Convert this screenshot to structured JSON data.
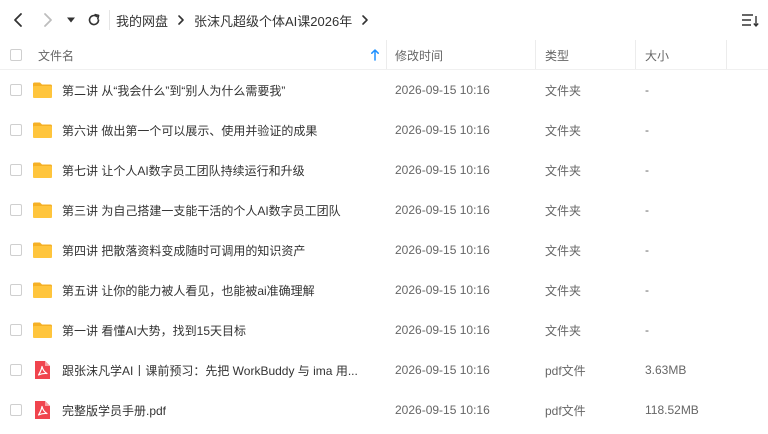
{
  "breadcrumb": {
    "items": [
      "我的网盘",
      "张沫凡超级个体AI课2026年"
    ]
  },
  "header": {
    "name": "文件名",
    "modified": "修改时间",
    "type": "类型",
    "size": "大小"
  },
  "files": [
    {
      "name": "第二讲 从“我会什么”到“别人为什么需要我”",
      "time": "2026-09-15 10:16",
      "type": "文件夹",
      "size": "-",
      "icon": "folder-icon"
    },
    {
      "name": "第六讲 做出第一个可以展示、使用并验证的成果",
      "time": "2026-09-15 10:16",
      "type": "文件夹",
      "size": "-",
      "icon": "folder-icon"
    },
    {
      "name": "第七讲 让个人AI数字员工团队持续运行和升级",
      "time": "2026-09-15 10:16",
      "type": "文件夹",
      "size": "-",
      "icon": "folder-icon"
    },
    {
      "name": "第三讲 为自己搭建一支能干活的个人AI数字员工团队",
      "time": "2026-09-15 10:16",
      "type": "文件夹",
      "size": "-",
      "icon": "folder-icon"
    },
    {
      "name": "第四讲 把散落资料变成随时可调用的知识资产",
      "time": "2026-09-15 10:16",
      "type": "文件夹",
      "size": "-",
      "icon": "folder-icon"
    },
    {
      "name": "第五讲 让你的能力被人看见，也能被ai准确理解",
      "time": "2026-09-15 10:16",
      "type": "文件夹",
      "size": "-",
      "icon": "folder-icon"
    },
    {
      "name": "第一讲 看懂AI大势，找到15天目标",
      "time": "2026-09-15 10:16",
      "type": "文件夹",
      "size": "-",
      "icon": "folder-icon"
    },
    {
      "name": "跟张沫凡学AI丨课前预习：先把 WorkBuddy 与 ima 用...",
      "time": "2026-09-15 10:16",
      "type": "pdf文件",
      "size": "3.63MB",
      "icon": "pdf-icon"
    },
    {
      "name": "完整版学员手册.pdf",
      "time": "2026-09-15 10:16",
      "type": "pdf文件",
      "size": "118.52MB",
      "icon": "pdf-icon"
    }
  ],
  "colors": {
    "folder": "#FFC53D",
    "folder_dark": "#F5B025",
    "pdf": "#F0444E",
    "sort_arrow": "#1E90FF"
  }
}
